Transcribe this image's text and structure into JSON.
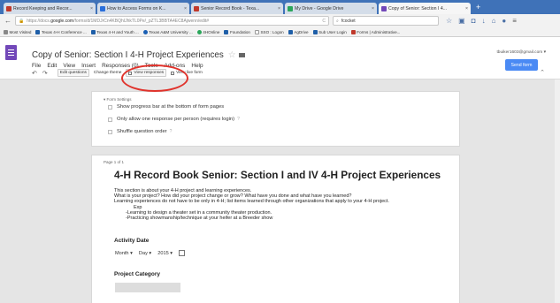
{
  "browser": {
    "tabs": [
      {
        "label": "Record Keeping and Recor...",
        "color": "#c0392b",
        "active": false
      },
      {
        "label": "How to Access Forms on K...",
        "color": "#2a6fdb",
        "active": false
      },
      {
        "label": "Senior Record Book - Texa...",
        "color": "#c0392b",
        "active": false
      },
      {
        "label": "My Drive - Google Drive",
        "color": "#2aa65a",
        "active": false
      },
      {
        "label": "Copy of Senior: Section I 4...",
        "color": "#7248b9",
        "active": true
      }
    ],
    "new_tab": "+",
    "url_prefix": "https://docs.",
    "url_domain": "google.com",
    "url_rest": "/forms/d/1MDJrCn4KBQhIJhkTL0Pe/_pZTL3BBTA4EC8Ajwenn/edit#",
    "url_refresh": "C",
    "search_value": "fcocket",
    "icons": [
      "back-icon",
      "forward-icon",
      "lock-icon",
      "bookmark-star-icon",
      "downloads-icon",
      "home-icon",
      "menu-icon"
    ]
  },
  "bookmarks": [
    "Most Visited",
    "Texas 4-H Conference ...",
    "Texas 4-H and Youth ...",
    "Texas A&M University ...",
    "4HOnline",
    "Foundation",
    "SSO : Logon",
    "AgDrive",
    "Sub User Login",
    "Forms | Administrative..."
  ],
  "forms": {
    "title": "Copy of Senior: Section I 4-H Project Experiences",
    "menu": [
      "File",
      "Edit",
      "View",
      "Insert",
      "Responses (0)",
      "Tools",
      "Add-ons",
      "Help"
    ],
    "user_email": "tbuiker1603@gmail.com ▾",
    "send_label": "Send form",
    "toolbar": {
      "edit_questions": "Edit questions",
      "change_theme": "Change theme",
      "view_responses": "View responses",
      "view_live": "View live form"
    }
  },
  "form_settings": {
    "label": "▾ Form Settings",
    "options": [
      {
        "label": "Show progress bar at the bottom of form pages",
        "help": ""
      },
      {
        "label": "Only allow one response per person (requires login)",
        "help": "?"
      },
      {
        "label": "Shuffle question order",
        "help": "?"
      }
    ]
  },
  "page": {
    "label": "Page 1 of 1",
    "title": "4-H Record Book Senior: Section I and IV 4-H Project Experiences",
    "description": [
      "This section is about your 4-H project and learning experiences.",
      "What is your project? How did your project change or grow? What have you done and what have you learned?",
      "Learning experiences do not have to be only in 4-H; list items learned through other organizations that apply to your 4-H project.",
      "Exp",
      "-Learning to design a theater set in a community theater production.",
      "-Practicing showmanship/technique at your heifer at a Breeder show"
    ],
    "activity_date_label": "Activity Date",
    "date_month": "Month",
    "date_day": "Day",
    "date_year": "2015",
    "project_category_label": "Project Category"
  },
  "annotation_color": "#e0332c"
}
